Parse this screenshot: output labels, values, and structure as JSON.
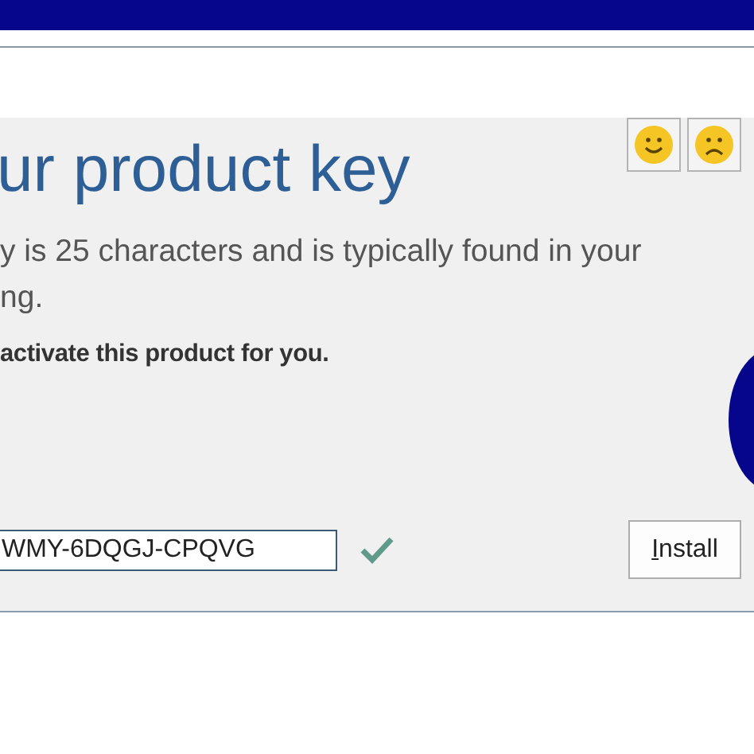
{
  "title": "ur product key",
  "description_lines": [
    "y is 25 characters and is typically found in your",
    "ng."
  ],
  "note": "activate this product for you.",
  "feedback_buttons": [
    {
      "kind": "smile"
    },
    {
      "kind": "frown"
    }
  ],
  "product_key": {
    "value": "WMY-6DQGJ-CPQVG",
    "valid": true
  },
  "install_button": {
    "label": "Install"
  }
}
